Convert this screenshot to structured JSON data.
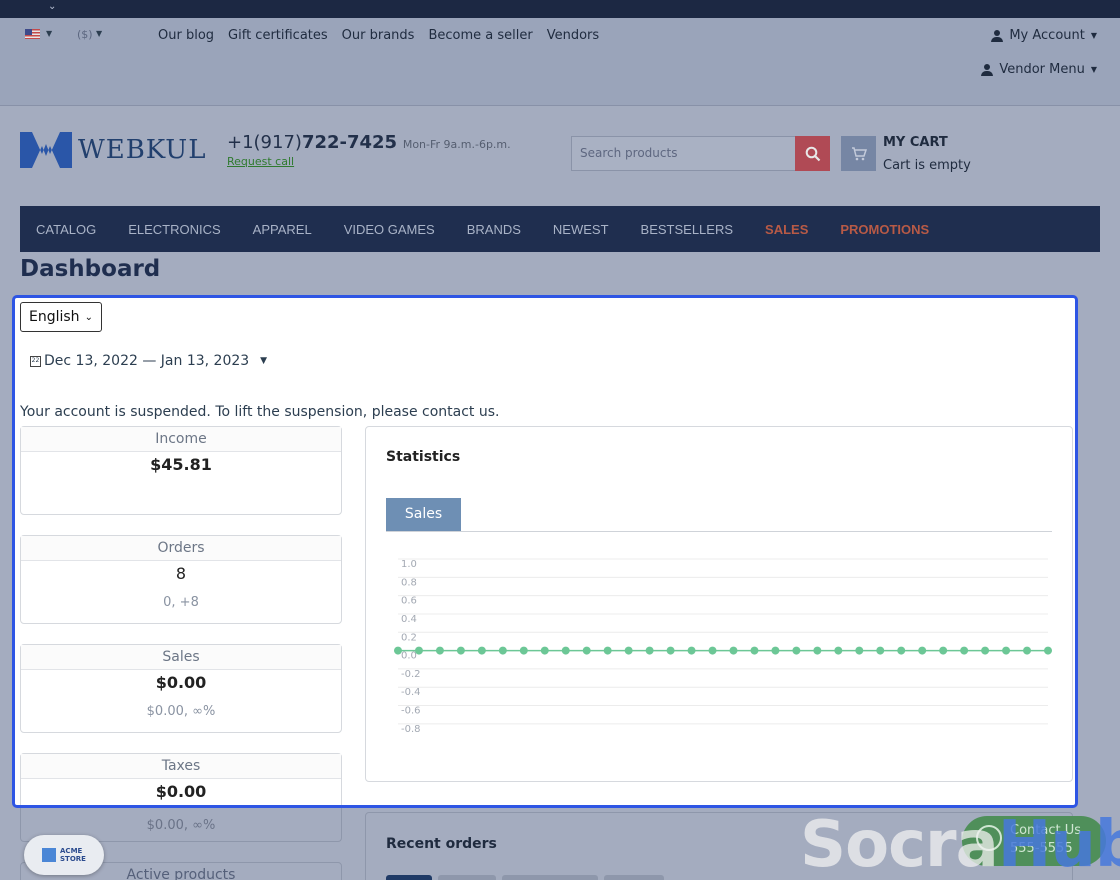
{
  "topbar": {
    "chevron_icon": "chevron-down-icon"
  },
  "header": {
    "currency": "($)",
    "links": [
      "Our blog",
      "Gift certificates",
      "Our brands",
      "Become a seller",
      "Vendors"
    ],
    "my_account": "My Account",
    "vendor_menu": "Vendor Menu"
  },
  "brand": {
    "logo_text": "WEBKUL",
    "phone_prefix": "+1(917)",
    "phone_main": "722-7425",
    "hours": "Mon-Fr 9a.m.-6p.m.",
    "request_call": "Request call"
  },
  "search": {
    "placeholder": "Search products"
  },
  "cart": {
    "title": "MY CART",
    "status": "Cart is empty"
  },
  "nav": {
    "items": [
      "CATALOG",
      "ELECTRONICS",
      "APPAREL",
      "VIDEO GAMES",
      "BRANDS",
      "NEWEST",
      "BESTSELLERS"
    ],
    "hot_items": [
      "SALES",
      "PROMOTIONS"
    ],
    "hot_color": "#b85a46"
  },
  "page": {
    "title": "Dashboard"
  },
  "dashboard": {
    "language": "English",
    "date_range": "Dec 13, 2022 — Jan 13, 2023",
    "notice": "Your account is suspended. To lift the suspension, please contact us.",
    "cards": [
      {
        "title": "Income",
        "value": "$45.81",
        "sub": ""
      },
      {
        "title": "Orders",
        "value": "8",
        "sub": "0, +8"
      },
      {
        "title": "Sales",
        "value": "$0.00",
        "sub": "$0.00, ∞%"
      },
      {
        "title": "Taxes",
        "value": "$0.00",
        "sub": "$0.00, ∞%"
      }
    ],
    "active_products_label": "Active products",
    "statistics_title": "Statistics",
    "statistics_tab": "Sales",
    "recent_orders_title": "Recent orders",
    "highlight_color": "#2e55e4"
  },
  "chart_data": {
    "type": "line",
    "title": "",
    "xlabel": "",
    "ylabel": "",
    "ylim": [
      -0.8,
      1.0
    ],
    "yticks": [
      "1.0",
      "0.8",
      "0.6",
      "0.4",
      "0.2",
      "0.0",
      "-0.2",
      "-0.4",
      "-0.6",
      "-0.8"
    ],
    "grid": true,
    "series": [
      {
        "color": "#6cc796",
        "values": [
          0,
          0,
          0,
          0,
          0,
          0,
          0,
          0,
          0,
          0,
          0,
          0,
          0,
          0,
          0,
          0,
          0,
          0,
          0,
          0,
          0,
          0,
          0,
          0,
          0,
          0,
          0,
          0,
          0,
          0,
          0,
          0
        ]
      }
    ]
  },
  "widgets": {
    "acme_label_1": "ACME",
    "acme_label_2": "STORE",
    "contact_label": "Contact Us",
    "contact_phone": "555-5555",
    "watermark_left": "Socra",
    "watermark_right": "Hub"
  }
}
